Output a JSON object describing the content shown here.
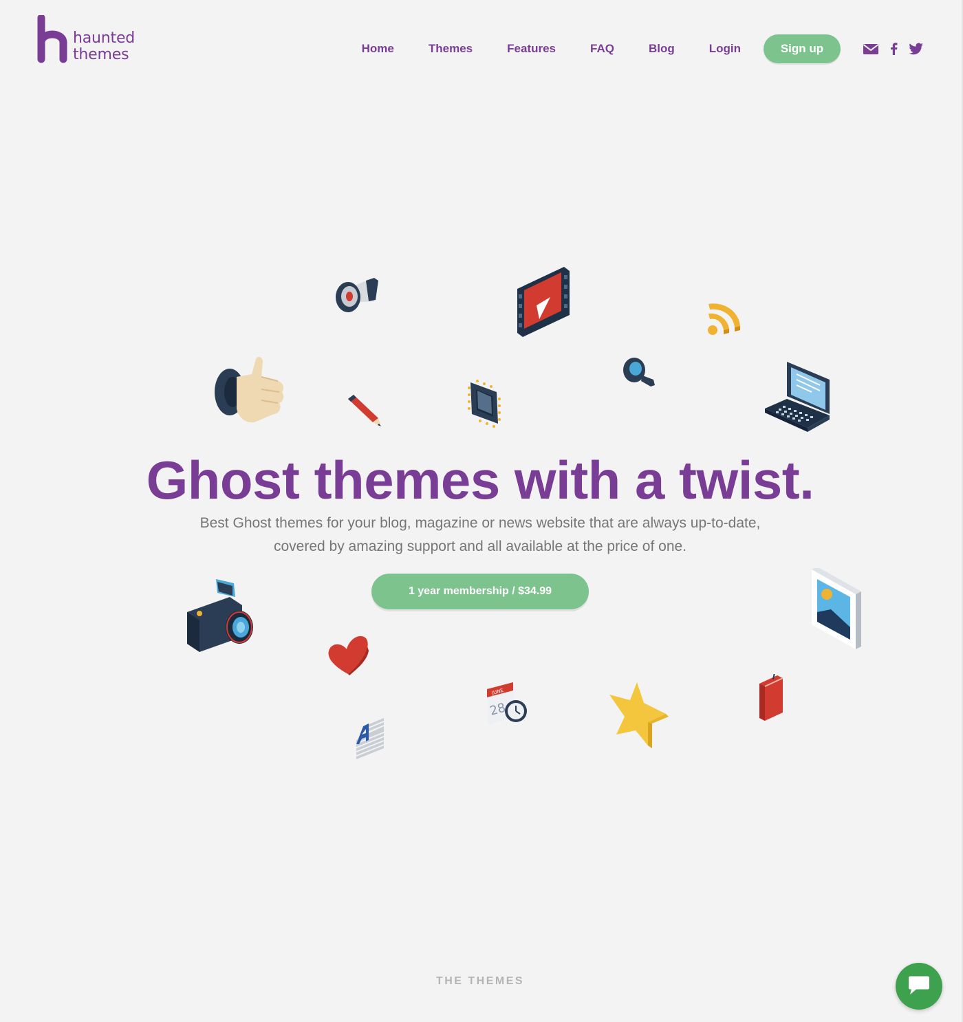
{
  "brand": {
    "line1": "haunted",
    "line2": "themes",
    "color": "#7a3d96"
  },
  "nav": {
    "items": [
      {
        "label": "Home"
      },
      {
        "label": "Themes"
      },
      {
        "label": "Features"
      },
      {
        "label": "FAQ"
      },
      {
        "label": "Blog"
      },
      {
        "label": "Login"
      }
    ],
    "signup_label": "Sign up",
    "social_icons": [
      "mail-icon",
      "facebook-icon",
      "twitter-icon"
    ]
  },
  "hero": {
    "title": "Ghost themes with a twist.",
    "subtitle": "Best Ghost themes for your blog, magazine or news website that are always up-to-date, covered by amazing support and all available at the price of one.",
    "cta_label": "1 year membership / $34.99"
  },
  "sections": {
    "themes_label": "THE THEMES"
  },
  "decorative_icons": [
    "megaphone-icon",
    "video-player-icon",
    "rss-icon",
    "thumbs-up-icon",
    "pencil-icon",
    "cpu-chip-icon",
    "magnifier-icon",
    "laptop-icon",
    "camera-icon",
    "heart-icon",
    "picture-frame-icon",
    "calendar-clock-icon",
    "star-icon",
    "book-icon",
    "font-stack-icon"
  ],
  "chat": {
    "icon": "chat-bubble-icon"
  },
  "colors": {
    "accent": "#7a3d96",
    "green": "#7dc38e",
    "chat_green": "#3ea14d",
    "background": "#f3f3f3",
    "body_text": "#767676"
  }
}
